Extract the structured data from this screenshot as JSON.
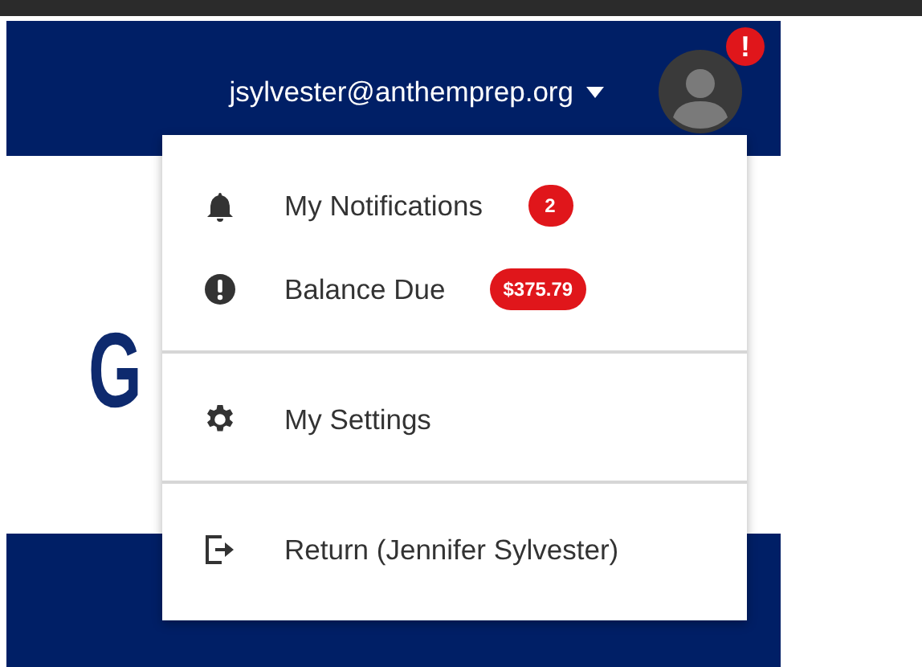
{
  "header": {
    "account": "jsylvester@anthemprep.org",
    "alert_badge": "!"
  },
  "logo_text": "G",
  "menu": {
    "sections": [
      {
        "items": [
          {
            "kind": "bell",
            "label": "My Notifications",
            "badge": "2"
          },
          {
            "kind": "alert",
            "label": "Balance Due",
            "badge": "$375.79"
          }
        ]
      },
      {
        "items": [
          {
            "kind": "gear",
            "label": "My Settings"
          }
        ]
      },
      {
        "items": [
          {
            "kind": "exit",
            "label": "Return (Jennifer Sylvester)"
          }
        ]
      }
    ]
  }
}
